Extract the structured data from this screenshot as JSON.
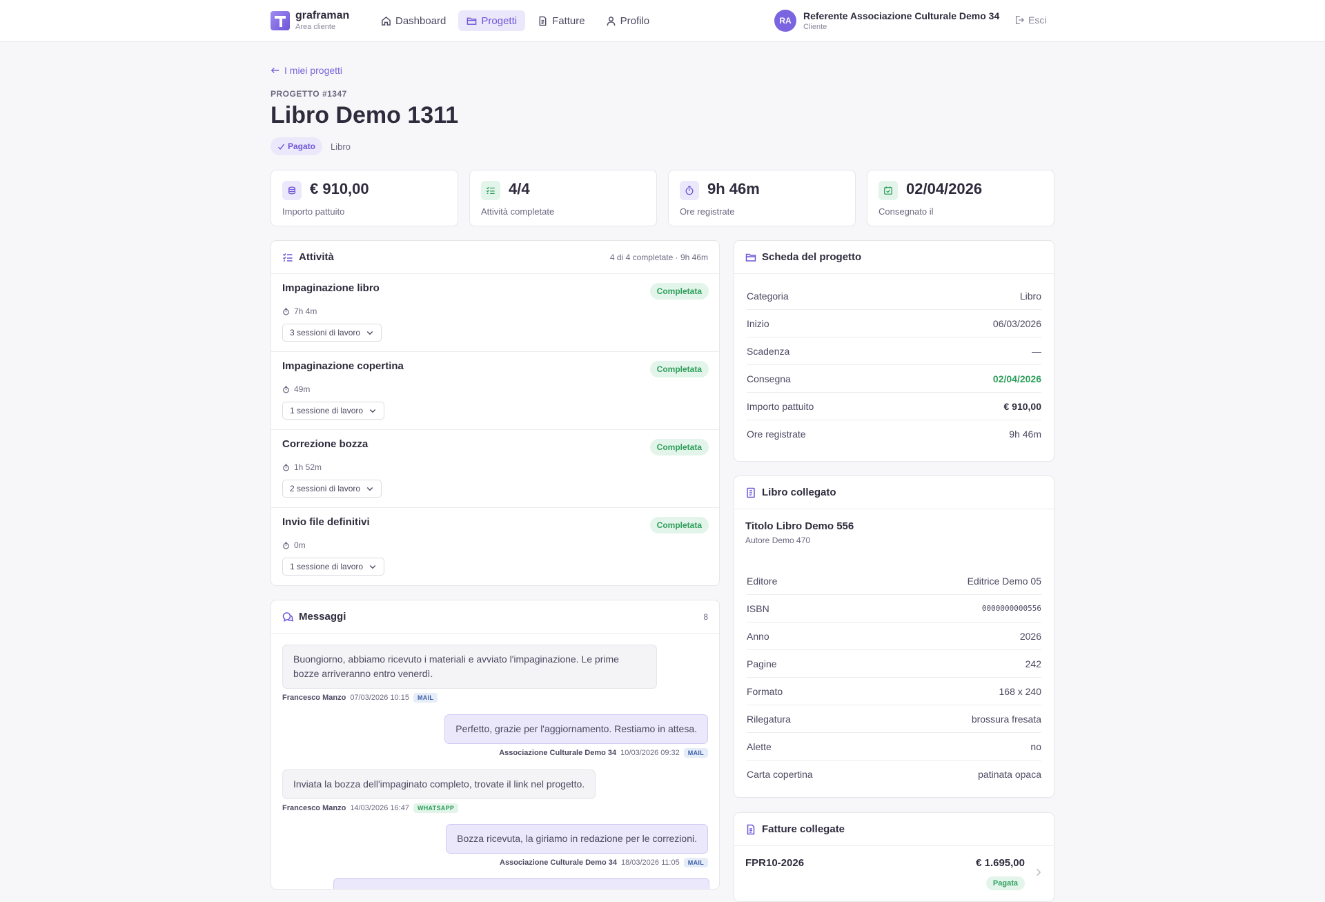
{
  "brand": {
    "name": "graframan",
    "subtitle": "Area cliente"
  },
  "nav": [
    {
      "label": "Dashboard",
      "icon": "home-icon",
      "active": false
    },
    {
      "label": "Progetti",
      "icon": "folder-icon",
      "active": true
    },
    {
      "label": "Fatture",
      "icon": "document-icon",
      "active": false
    },
    {
      "label": "Profilo",
      "icon": "user-icon",
      "active": false
    }
  ],
  "user": {
    "initials": "RA",
    "name": "Referente Associazione Culturale Demo 34",
    "role": "Cliente"
  },
  "logout_label": "Esci",
  "back_label": "I miei progetti",
  "project": {
    "code": "PROGETTO #1347",
    "title": "Libro Demo 1311",
    "status": "Pagato",
    "category": "Libro"
  },
  "stats": [
    {
      "value": "€ 910,00",
      "label": "Importo pattuito"
    },
    {
      "value": "4/4",
      "label": "Attività completate"
    },
    {
      "value": "9h 46m",
      "label": "Ore registrate"
    },
    {
      "value": "02/04/2026",
      "label": "Consegnato il"
    }
  ],
  "activities": {
    "title": "Attività",
    "meta": "4 di 4 completate · 9h 46m",
    "items": [
      {
        "name": "Impaginazione libro",
        "status": "Completata",
        "time": "7h 4m",
        "sessions": "3 sessioni di lavoro"
      },
      {
        "name": "Impaginazione copertina",
        "status": "Completata",
        "time": "49m",
        "sessions": "1 sessione di lavoro"
      },
      {
        "name": "Correzione bozza",
        "status": "Completata",
        "time": "1h 52m",
        "sessions": "2 sessioni di lavoro"
      },
      {
        "name": "Invio file definitivi",
        "status": "Completata",
        "time": "0m",
        "sessions": "1 sessione di lavoro"
      }
    ]
  },
  "messages": {
    "title": "Messaggi",
    "count": "8",
    "items": [
      {
        "text": "Buongiorno, abbiamo ricevuto i materiali e avviato l'impaginazione. Le prime bozze arriveranno entro venerdì.",
        "sender": "Francesco Manzo",
        "date": "07/03/2026 10:15",
        "channel": "MAIL"
      },
      {
        "text": "Perfetto, grazie per l'aggiornamento. Restiamo in attesa.",
        "sender": "Associazione Culturale Demo 34",
        "date": "10/03/2026 09:32",
        "channel": "MAIL"
      },
      {
        "text": "Inviata la bozza dell'impaginato completo, trovate il link nel progetto.",
        "sender": "Francesco Manzo",
        "date": "14/03/2026 16:47",
        "channel": "WHATSAPP"
      },
      {
        "text": "Bozza ricevuta, la giriamo in redazione per le correzioni.",
        "sender": "Associazione Culturale Demo 34",
        "date": "18/03/2026 11:05",
        "channel": "MAIL"
      }
    ]
  },
  "sheet": {
    "title": "Scheda del progetto",
    "rows": [
      {
        "k": "Categoria",
        "v": "Libro"
      },
      {
        "k": "Inizio",
        "v": "06/03/2026"
      },
      {
        "k": "Scadenza",
        "v": "—"
      },
      {
        "k": "Consegna",
        "v": "02/04/2026"
      },
      {
        "k": "Importo pattuito",
        "v": "€ 910,00"
      },
      {
        "k": "Ore registrate",
        "v": "9h 46m"
      }
    ]
  },
  "book": {
    "title": "Libro collegato",
    "name": "Titolo Libro Demo 556",
    "author": "Autore Demo 470",
    "rows": [
      {
        "k": "Editore",
        "v": "Editrice Demo 05"
      },
      {
        "k": "ISBN",
        "v": "0000000000556"
      },
      {
        "k": "Anno",
        "v": "2026"
      },
      {
        "k": "Pagine",
        "v": "242"
      },
      {
        "k": "Formato",
        "v": "168 x 240"
      },
      {
        "k": "Rilegatura",
        "v": "brossura fresata"
      },
      {
        "k": "Alette",
        "v": "no"
      },
      {
        "k": "Carta copertina",
        "v": "patinata opaca"
      }
    ]
  },
  "invoices": {
    "title": "Fatture collegate",
    "items": [
      {
        "number": "FPR10-2026",
        "amount": "€ 1.695,00",
        "status": "Pagata"
      }
    ]
  }
}
